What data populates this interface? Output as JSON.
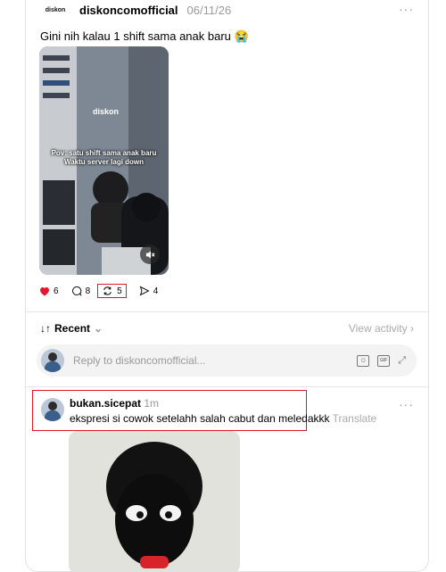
{
  "post": {
    "username": "diskoncomofficial",
    "logo_text": "diskon",
    "date": "06/11/26",
    "caption": "Gini nih kalau 1 shift sama anak baru 😭",
    "video": {
      "logo": "diskon",
      "overlay_line1": "Pov: satu shift sama anak baru",
      "overlay_line2": "Waktu server lagi down",
      "mute_icon": "speaker-muted-icon"
    },
    "likes": "6",
    "comments": "8",
    "reposts": "5",
    "shares": "4"
  },
  "sort": {
    "label": "Recent",
    "view_activity": "View activity"
  },
  "reply": {
    "placeholder": "Reply to diskoncomofficial...",
    "gif_label": "GIF"
  },
  "comment": {
    "username": "bukan.sicepat",
    "time": "1m",
    "text": "ekspresi si cowok setelahh salah cabut dan meledakkk",
    "translate": "Translate"
  },
  "colors": {
    "like": "#e0182e",
    "highlight": "#e0182e"
  }
}
